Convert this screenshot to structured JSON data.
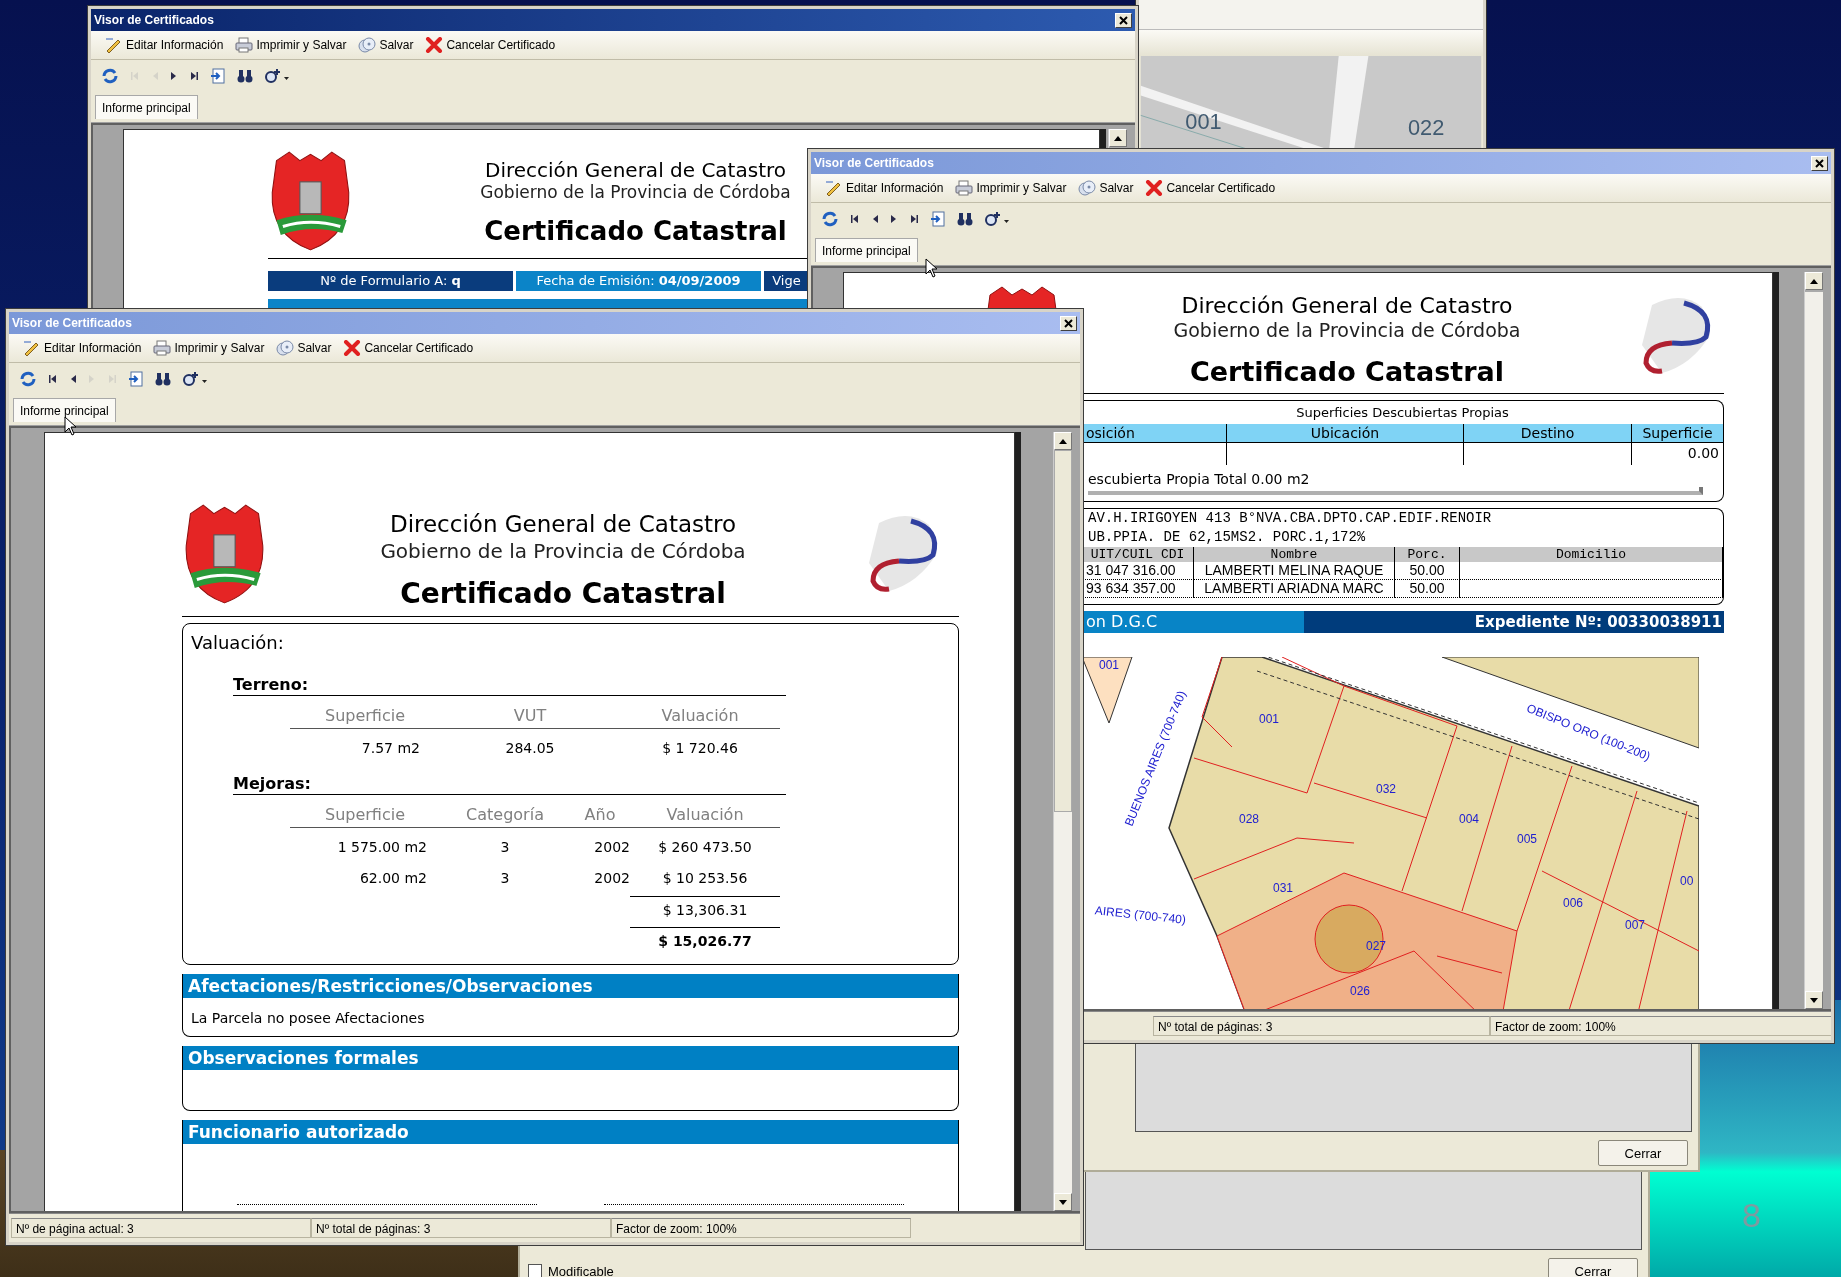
{
  "slide_number": "8",
  "map_window": {
    "labels": [
      "001",
      "022"
    ]
  },
  "dialogs": [
    {
      "kind": "lower",
      "checkbox": {
        "label": "Modificable",
        "checked": false
      },
      "button": "Cerrar"
    },
    {
      "kind": "upper",
      "button": "Cerrar"
    }
  ],
  "viewers": [
    {
      "kind": "back",
      "title": "Visor de Certificados",
      "active": true,
      "toolbar": [
        {
          "kind": "edit",
          "label": "Editar Información"
        },
        {
          "kind": "print",
          "label": "Imprimir y Salvar"
        },
        {
          "kind": "save",
          "label": "Salvar"
        },
        {
          "kind": "cancel",
          "label": "Cancelar Certificado"
        }
      ],
      "nav": [
        {
          "kind": "refresh",
          "disabled": false
        },
        {
          "kind": "first",
          "disabled": true
        },
        {
          "kind": "prev",
          "disabled": true
        },
        {
          "kind": "next",
          "disabled": false
        },
        {
          "kind": "last",
          "disabled": false
        },
        {
          "kind": "export",
          "disabled": false
        },
        {
          "kind": "find",
          "disabled": false
        },
        {
          "kind": "zoom",
          "disabled": false
        }
      ],
      "tab": {
        "label": "Informe principal",
        "selected": true
      },
      "report": {
        "agency": "Dirección General de Catastro",
        "government": "Gobierno de la Provincia de Córdoba",
        "title": "Certificado Catastral",
        "fields": [
          {
            "label": "Nº de Formulario A:",
            "value": "q",
            "color": "#0a3c7d"
          },
          {
            "label": "Fecha de Emisión:",
            "value": "04/09/2009",
            "color": "#0b84c8"
          },
          {
            "label": "Vige",
            "color": "#0a3c7d"
          }
        ]
      }
    },
    {
      "kind": "middle",
      "title": "Visor de Certificados",
      "active": false,
      "toolbar": [
        {
          "kind": "edit",
          "label": "Editar Información"
        },
        {
          "kind": "print",
          "label": "Imprimir y Salvar"
        },
        {
          "kind": "save",
          "label": "Salvar"
        },
        {
          "kind": "cancel",
          "label": "Cancelar Certificado"
        }
      ],
      "nav": [
        {
          "kind": "refresh",
          "disabled": false
        },
        {
          "kind": "first",
          "disabled": false
        },
        {
          "kind": "prev",
          "disabled": false
        },
        {
          "kind": "next",
          "disabled": false
        },
        {
          "kind": "last",
          "disabled": false
        },
        {
          "kind": "export",
          "disabled": false
        },
        {
          "kind": "find",
          "disabled": false
        },
        {
          "kind": "zoom",
          "disabled": false
        }
      ],
      "tab": {
        "label": "Informe principal",
        "selected": true
      },
      "report": {
        "agency": "Dirección General de Catastro",
        "government": "Gobierno de la Provincia de Córdoba",
        "title": "Certificado Catastral",
        "surfaces": {
          "caption": "Superficies Descubiertas Propias",
          "columns": [
            "osición",
            "Ubicación",
            "Destino",
            "Superficie"
          ],
          "rows": [
            {
              "superficie": "0.00"
            }
          ],
          "total": "escubierta Propia Total 0.00 m2"
        },
        "ownership": {
          "lines": [
            "AV.H.IRIGOYEN 413 B°NVA.CBA.DPTO.CAP.EDIF.RENOIR",
            "UB.PPIA. DE 62,15MS2. PORC.1,172%"
          ],
          "columns": [
            "UIT/CUIL CDI",
            "Nombre",
            "Porc.",
            "Domicilio"
          ],
          "rows": [
            {
              "id": "31 047 316.00",
              "name": "LAMBERTI MELINA RAQUE",
              "share": "50.00"
            },
            {
              "id": "93 634 357.00",
              "name": "LAMBERTI ARIADNA MARC",
              "share": "50.00"
            }
          ]
        },
        "band": {
          "left": "on D.G.C",
          "right": "Expediente Nº: 00330038911"
        },
        "map": {
          "parcels": [
            "001",
            "001",
            "032",
            "028",
            "004",
            "005",
            "031",
            "006",
            "007",
            "027",
            "026",
            "00"
          ],
          "streets": [
            "BUENOS AIRES (700-740)",
            "OBISPO ORO (100-200)",
            "AIRES (700-740)"
          ]
        }
      },
      "status_bar": [
        "Nº total de páginas: 3",
        "Factor de zoom: 100%"
      ]
    },
    {
      "kind": "front",
      "title": "Visor de Certificados",
      "active": false,
      "toolbar": [
        {
          "kind": "edit",
          "label": "Editar Información"
        },
        {
          "kind": "print",
          "label": "Imprimir y Salvar"
        },
        {
          "kind": "save",
          "label": "Salvar"
        },
        {
          "kind": "cancel",
          "label": "Cancelar Certificado"
        }
      ],
      "nav": [
        {
          "kind": "refresh",
          "disabled": false
        },
        {
          "kind": "first",
          "disabled": false
        },
        {
          "kind": "prev",
          "disabled": false
        },
        {
          "kind": "next",
          "disabled": true
        },
        {
          "kind": "last",
          "disabled": true
        },
        {
          "kind": "export",
          "disabled": false
        },
        {
          "kind": "find",
          "disabled": false
        },
        {
          "kind": "zoom",
          "disabled": false
        }
      ],
      "tab": {
        "label": "Informe principal",
        "selected": true
      },
      "report": {
        "agency": "Dirección General de Catastro",
        "government": "Gobierno de la Provincia de Córdoba",
        "title": "Certificado Catastral",
        "valuation": {
          "heading": "Valuación:",
          "land": {
            "heading": "Terreno:",
            "columns": [
              "Superficie",
              "VUT",
              "Valuación"
            ],
            "rows": [
              [
                "7.57 m2",
                "284.05",
                "$ 1 720.46"
              ]
            ]
          },
          "improvements": {
            "heading": "Mejoras:",
            "columns": [
              "Superficie",
              "Categoría",
              "Año",
              "Valuación"
            ],
            "rows": [
              [
                "1 575.00 m2",
                "3",
                "2002",
                "$ 260 473.50"
              ],
              [
                "62.00 m2",
                "3",
                "2002",
                "$ 10 253.56"
              ]
            ],
            "subtotal": "$ 13,306.31",
            "total": "$ 15,026.77"
          }
        },
        "sections": [
          {
            "heading": "Afectaciones/Restricciones/Observaciones",
            "body": "La Parcela no posee Afectaciones"
          },
          {
            "heading": "Observaciones formales"
          },
          {
            "heading": "Funcionario autorizado",
            "signatures": true
          }
        ]
      },
      "status_bar": [
        "Nº de página actual: 3",
        "Nº total de páginas: 3",
        "Factor de zoom: 100%"
      ]
    }
  ]
}
